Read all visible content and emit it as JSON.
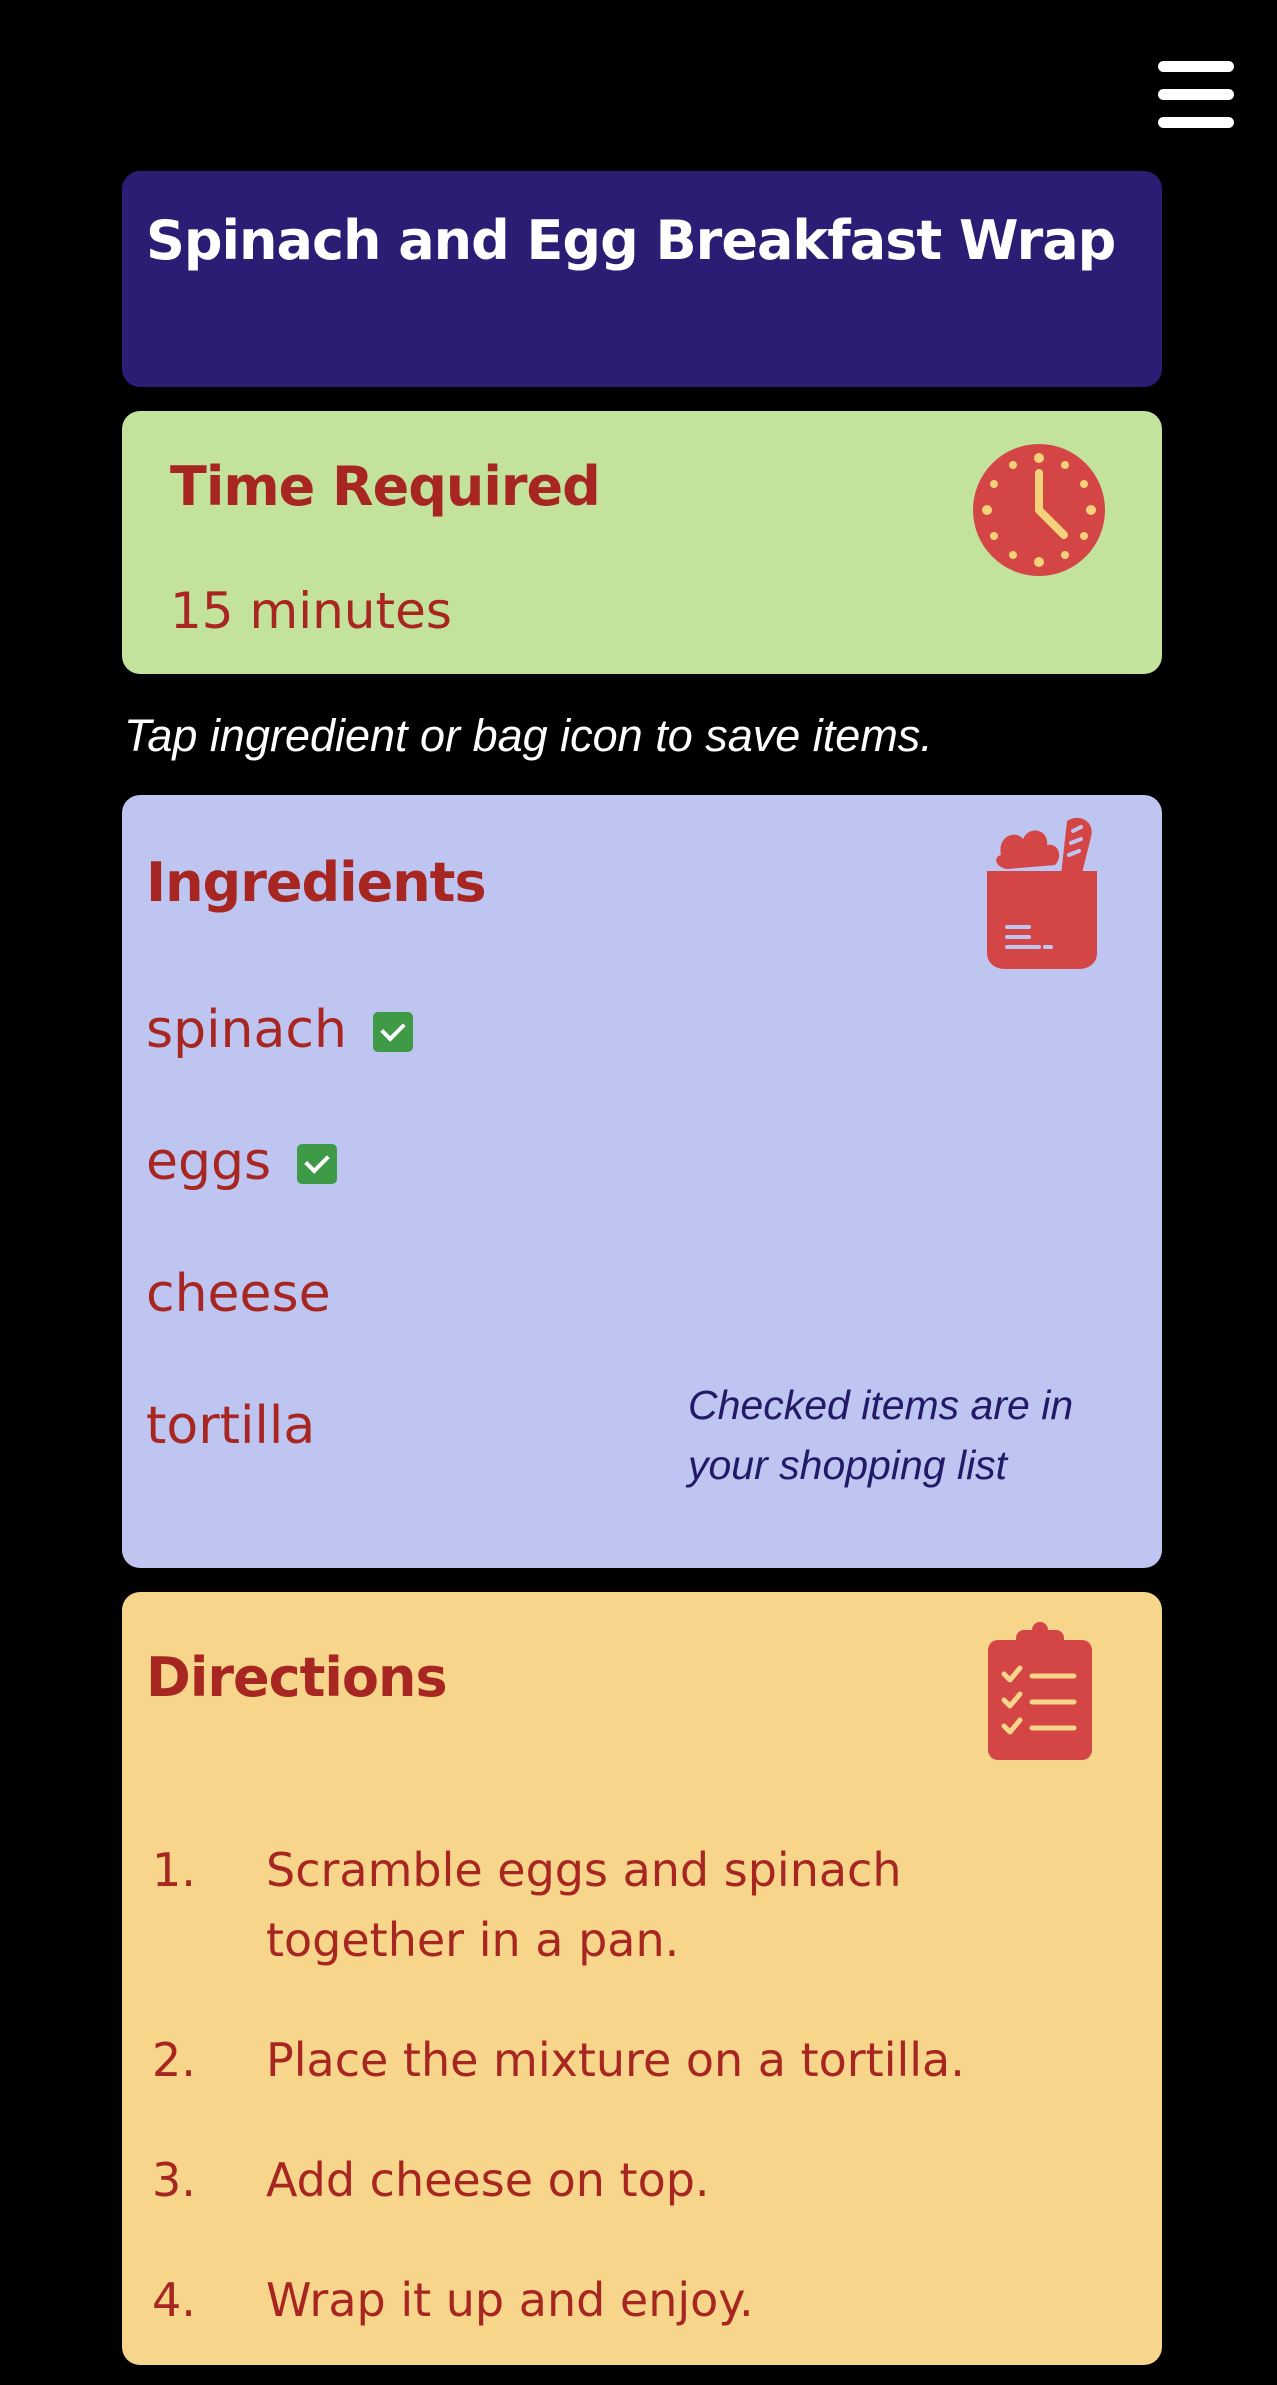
{
  "menu": {
    "icon": "hamburger-menu-icon"
  },
  "recipe": {
    "title": "Spinach and Egg Breakfast Wrap"
  },
  "time": {
    "heading": "Time Required",
    "value": "15 minutes",
    "icon": "clock-icon"
  },
  "hint": "Tap ingredient or bag icon to save items.",
  "ingredients": {
    "heading": "Ingredients",
    "icon": "shopping-bag-icon",
    "items": [
      {
        "name": "spinach",
        "checked": true
      },
      {
        "name": "eggs",
        "checked": true
      },
      {
        "name": "cheese",
        "checked": false
      },
      {
        "name": "tortilla",
        "checked": false
      }
    ],
    "note": "Checked items are in your shopping list"
  },
  "directions": {
    "heading": "Directions",
    "icon": "clipboard-checklist-icon",
    "steps": [
      {
        "num": "1.",
        "text": "Scramble eggs and spinach together in a pan."
      },
      {
        "num": "2.",
        "text": "Place the mixture on a tortilla."
      },
      {
        "num": "3.",
        "text": "Add cheese on top."
      },
      {
        "num": "4.",
        "text": "Wrap it up and enjoy."
      }
    ]
  },
  "colors": {
    "background": "#000000",
    "title_card": "#2b1d73",
    "time_card": "#c3e29c",
    "ingredients_card": "#bec5f0",
    "directions_card": "#f7d58b",
    "accent_red": "#a82621",
    "icon_red": "#d44545",
    "check_green": "#3e9a47"
  }
}
